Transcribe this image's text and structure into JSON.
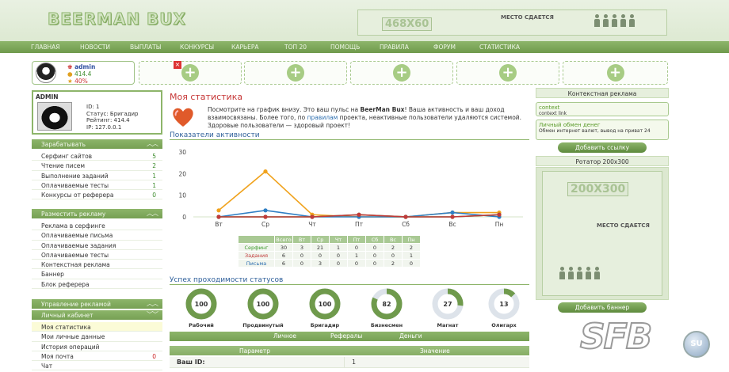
{
  "header": {
    "logo": "BEERMAN BUX",
    "banner_top": {
      "size": "468X60",
      "text": "МЕСТО СДАЕТСЯ"
    }
  },
  "nav": [
    "ГЛАВНАЯ",
    "НОВОСТИ",
    "ВЫПЛАТЫ",
    "КОНКУРСЫ",
    "КАРЬЕРА",
    "ТОП 20",
    "ПОМОЩЬ",
    "ПРАВИЛА",
    "ФОРУМ",
    "СТАТИСТИКА"
  ],
  "userbar": {
    "name": "admin",
    "balance": "414.4",
    "percent": "40%"
  },
  "profile": {
    "title": "ADMIN",
    "id": "ID: 1",
    "status": "Статус: Бригадир",
    "rating": "Рейтинг: 414.4",
    "ip": "IP: 127.0.0.1"
  },
  "earn": {
    "title": "Зарабатывать",
    "items": [
      {
        "label": "Серфинг сайтов",
        "value": "5"
      },
      {
        "label": "Чтение писем",
        "value": "2"
      },
      {
        "label": "Выполнение заданий",
        "value": "1"
      },
      {
        "label": "Оплачиваемые тесты",
        "value": "1"
      },
      {
        "label": "Конкурсы от реферера",
        "value": "0"
      }
    ]
  },
  "advertise": {
    "title": "Разместить рекламу",
    "items": [
      "Реклама в серфинге",
      "Оплачиваемые письма",
      "Оплачиваемые задания",
      "Оплачиваемые тесты",
      "Контекстная реклама",
      "Баннер",
      "Блок реферера"
    ]
  },
  "manage": {
    "title": "Управление рекламой"
  },
  "cabinet": {
    "title": "Личный кабинет",
    "items": [
      {
        "label": "Моя статистика",
        "value": ""
      },
      {
        "label": "Мои личные данные",
        "value": ""
      },
      {
        "label": "История операций",
        "value": ""
      },
      {
        "label": "Моя почта",
        "value": "0"
      },
      {
        "label": "Чат",
        "value": ""
      }
    ]
  },
  "main": {
    "title": "Моя статистика",
    "intro_1": "Посмотрите на график внизу. Это ваш пульс на ",
    "intro_brand": "BeerMan Bux",
    "intro_2": "! Ваша активность и ваш доход взаимосвязаны. Более того, по ",
    "intro_link": "правилам",
    "intro_3": " проекта, неактивные пользователи удаляются системой. Здоровые пользователи — здоровый проект!",
    "activity_title": "Показатели активности",
    "status_title": "Успех проходимости статусов",
    "tabs": [
      "Личное",
      "Рефералы",
      "Деньги"
    ],
    "columns": [
      "Параметр",
      "Значение"
    ],
    "row": {
      "label": "Ваш ID:",
      "value": "1"
    }
  },
  "stats_table": {
    "headers": [
      "Всего",
      "Вт",
      "Ср",
      "Чт",
      "Пт",
      "Сб",
      "Вс",
      "Пн"
    ],
    "rows": [
      {
        "label": "Серфинг",
        "color": "#3c9a2c",
        "values": [
          "30",
          "3",
          "21",
          "1",
          "0",
          "0",
          "2",
          "2"
        ]
      },
      {
        "label": "Задания",
        "color": "#c23a3a",
        "values": [
          "6",
          "0",
          "0",
          "0",
          "1",
          "0",
          "0",
          "1"
        ]
      },
      {
        "label": "Письма",
        "color": "#2e6fb0",
        "values": [
          "6",
          "0",
          "3",
          "0",
          "0",
          "0",
          "2",
          "0"
        ]
      }
    ]
  },
  "chart_data": {
    "type": "line",
    "categories": [
      "Вт",
      "Ср",
      "Чт",
      "Пт",
      "Сб",
      "Вс",
      "Пн"
    ],
    "ylim": [
      0,
      30
    ],
    "yticks": [
      "0",
      "10",
      "20",
      "30"
    ],
    "grid": false,
    "series": [
      {
        "color": "#f0a21c",
        "values": [
          3,
          21,
          1,
          0,
          0,
          2,
          2
        ]
      },
      {
        "color": "#2f7fc4",
        "values": [
          0,
          3,
          0,
          0,
          0,
          2,
          0
        ]
      },
      {
        "color": "#3c9a2c",
        "values": [
          0,
          0,
          0,
          1,
          0,
          0,
          1
        ]
      },
      {
        "color": "#c23a3a",
        "values": [
          0,
          0,
          0,
          1,
          0,
          0,
          1
        ]
      }
    ]
  },
  "statuses": [
    {
      "label": "Рабочий",
      "value": "100",
      "pct": 1.0
    },
    {
      "label": "Продвинутый",
      "value": "100",
      "pct": 1.0
    },
    {
      "label": "Бригадир",
      "value": "100",
      "pct": 1.0
    },
    {
      "label": "Бизнесмен",
      "value": "82",
      "pct": 0.82
    },
    {
      "label": "Магнат",
      "value": "27",
      "pct": 0.27
    },
    {
      "label": "Олигарх",
      "value": "13",
      "pct": 0.13
    }
  ],
  "right": {
    "context_title": "Контекстная реклама",
    "ad1": {
      "title": "context",
      "desc": "context link"
    },
    "ad2": {
      "title": "Личный обмен денег",
      "desc": "Обмен интернет валют, вывод на приват 24"
    },
    "add_link": "Добавить ссылку",
    "rotator_title": "Ротатор 200x300",
    "banner_size": "200X300",
    "banner_text": "МЕСТО СДАЕТСЯ",
    "add_banner": "Добавить баннер"
  },
  "watermark": {
    "text": "SFB",
    "suffix": "SU"
  }
}
